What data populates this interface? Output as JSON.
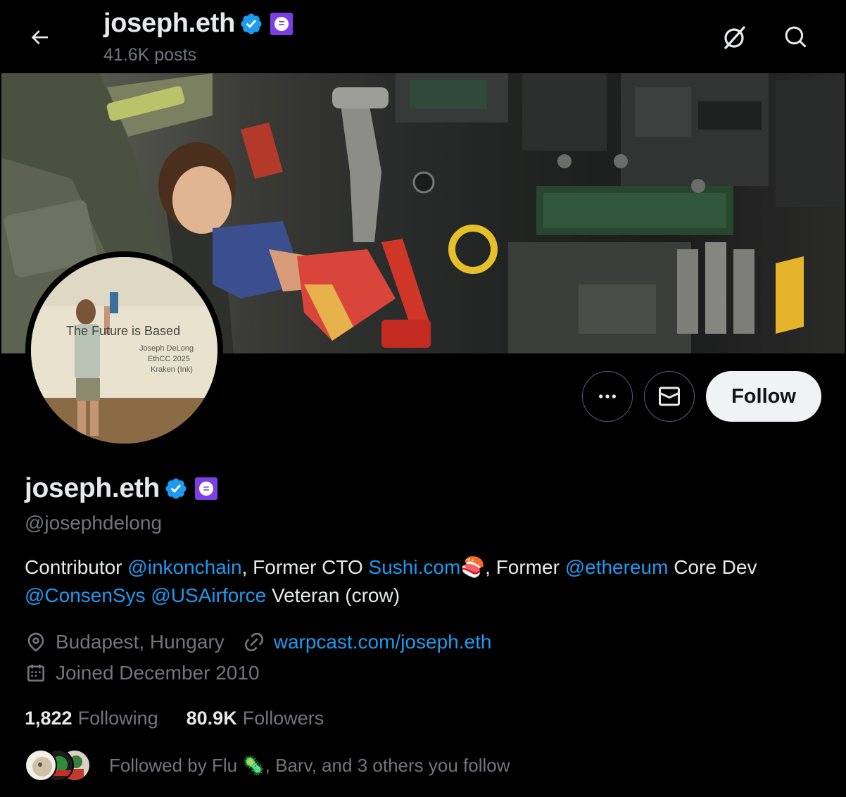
{
  "header": {
    "title": "joseph.eth",
    "posts_count": "41.6K posts",
    "icons": [
      "back-arrow-icon",
      "verified-badge-icon",
      "affiliate-badge-icon",
      "grok-icon",
      "search-icon"
    ]
  },
  "profile": {
    "avatar_text": {
      "line1": "The Future is Based",
      "line2": "Joseph DeLong",
      "line3": "EthCC 2025",
      "line4": "Kraken (Ink)"
    },
    "name": "joseph.eth",
    "handle": "@josephdelong",
    "bio": {
      "p1": "Contributor ",
      "link1": "@inkonchain",
      "p2": ", Former CTO ",
      "link2": "Sushi.com",
      "emoji": "🍣",
      "p3": ", Former ",
      "link3": "@ethereum",
      "p4": " Core Dev",
      "link4": "@ConsenSys",
      "link5": "@USAirforce",
      "p5": " Veteran (crow)"
    },
    "location": "Budapest, Hungary",
    "url": "warpcast.com/joseph.eth",
    "joined": "Joined December 2010",
    "following_count": "1,822",
    "following_label": "Following",
    "followers_count": "80.9K",
    "followers_label": "Followers",
    "followed_by": "Followed by Flu 🦠, Barv, and 3 others you follow"
  },
  "actions": {
    "follow_label": "Follow",
    "more_label": "•••"
  },
  "colors": {
    "accent": "#1d9bf0",
    "verified": "#1d9bf0",
    "affiliate": "#7b3fe4",
    "muted": "#71767b",
    "text": "#e7e9ea",
    "follow_bg": "#eff3f4"
  }
}
